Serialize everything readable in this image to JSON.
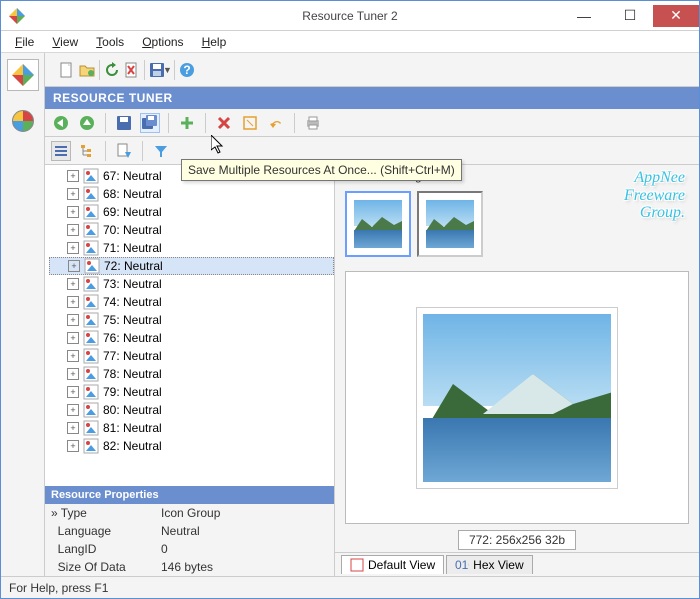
{
  "title": "Resource Tuner 2",
  "menu": [
    "File",
    "View",
    "Tools",
    "Options",
    "Help"
  ],
  "appheader": "RESOURCE TUNER",
  "tooltip": "Save Multiple Resources At Once... (Shift+Ctrl+M)",
  "tree": [
    {
      "id": 67,
      "label": "67: Neutral",
      "sel": false
    },
    {
      "id": 68,
      "label": "68: Neutral",
      "sel": false
    },
    {
      "id": 69,
      "label": "69: Neutral",
      "sel": false
    },
    {
      "id": 70,
      "label": "70: Neutral",
      "sel": false
    },
    {
      "id": 71,
      "label": "71: Neutral",
      "sel": false
    },
    {
      "id": 72,
      "label": "72: Neutral",
      "sel": true
    },
    {
      "id": 73,
      "label": "73: Neutral",
      "sel": false
    },
    {
      "id": 74,
      "label": "74: Neutral",
      "sel": false
    },
    {
      "id": 75,
      "label": "75: Neutral",
      "sel": false
    },
    {
      "id": 76,
      "label": "76: Neutral",
      "sel": false
    },
    {
      "id": 77,
      "label": "77: Neutral",
      "sel": false
    },
    {
      "id": 78,
      "label": "78: Neutral",
      "sel": false
    },
    {
      "id": 79,
      "label": "79: Neutral",
      "sel": false
    },
    {
      "id": 80,
      "label": "80: Neutral",
      "sel": false
    },
    {
      "id": 81,
      "label": "81: Neutral",
      "sel": false
    },
    {
      "id": 82,
      "label": "82: Neutral",
      "sel": false
    }
  ],
  "props_header": "Resource Properties",
  "props": [
    {
      "k": "Type",
      "v": "Icon Group",
      "prefix": "»"
    },
    {
      "k": "Language",
      "v": "Neutral",
      "prefix": ""
    },
    {
      "k": "LangID",
      "v": "0",
      "prefix": ""
    },
    {
      "k": "Size Of Data",
      "v": "146 bytes",
      "prefix": ""
    }
  ],
  "selected_image_label": "Selected Image",
  "dim_label": "772: 256x256 32b",
  "tabs": [
    {
      "label": "Default View",
      "active": true
    },
    {
      "label": "Hex View",
      "active": false
    }
  ],
  "status": "For Help, press F1",
  "watermark": "AppNee\nFreeware\nGroup."
}
